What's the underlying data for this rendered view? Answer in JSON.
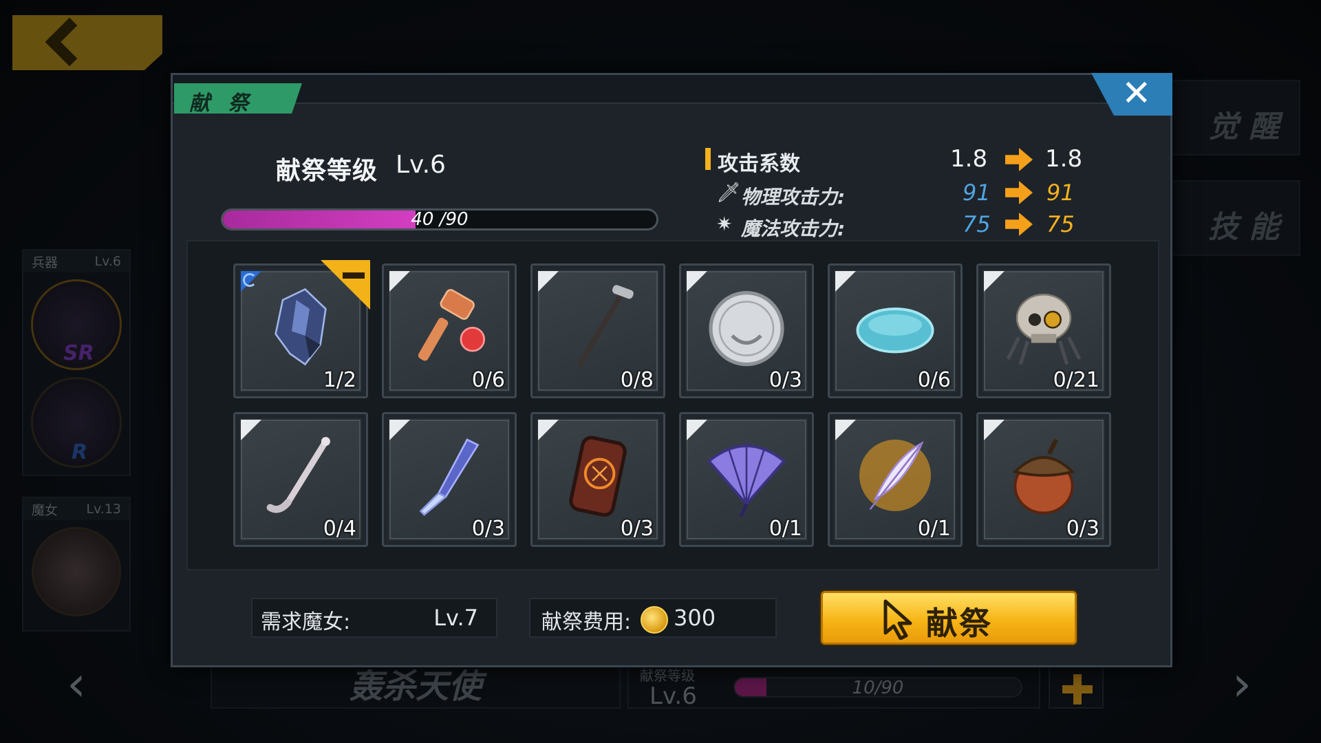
{
  "background": {
    "side_cards": [
      {
        "title": "兵器",
        "level": "Lv.6",
        "rarity": "SR",
        "rarity2": "R"
      },
      {
        "title": "魔女",
        "level": "Lv.13"
      }
    ],
    "right_tabs": [
      "觉 醒",
      "技 能"
    ],
    "bottom": {
      "name": "轰杀天使",
      "level_label": "献祭等级",
      "level_value": "Lv.6",
      "progress_text": "10/90",
      "progress": 0.11
    }
  },
  "modal": {
    "title": "献 祭",
    "close_label": "✕",
    "level_label": "献祭等级",
    "level_value": "Lv.6",
    "progress_text": "40 /90",
    "progress": 0.444,
    "stats": {
      "header": "攻击系数",
      "coef_from": "1.8",
      "coef_to": "1.8",
      "physical_label": "物理攻击力:",
      "physical_from": "91",
      "physical_to": "91",
      "magic_label": "魔法攻击力:",
      "magic_from": "75",
      "magic_to": "75"
    },
    "items": [
      {
        "name": "crystal-shard",
        "count": "1/2",
        "selected": true
      },
      {
        "name": "toy-mallet",
        "count": "0/6"
      },
      {
        "name": "walking-cane",
        "count": "0/8"
      },
      {
        "name": "silver-coin",
        "count": "0/3"
      },
      {
        "name": "soap-bar",
        "count": "0/6"
      },
      {
        "name": "spider-skull",
        "count": "0/21"
      },
      {
        "name": "pipe",
        "count": "0/4"
      },
      {
        "name": "butterfly-knife",
        "count": "0/3"
      },
      {
        "name": "rune-tablet",
        "count": "0/3"
      },
      {
        "name": "folding-fan",
        "count": "0/1"
      },
      {
        "name": "feather",
        "count": "0/1"
      },
      {
        "name": "acorn",
        "count": "0/3"
      }
    ],
    "requirement_label": "需求魔女:",
    "requirement_value": "Lv.7",
    "cost_label": "献祭费用:",
    "cost_value": "300",
    "sacrifice_button": "献祭"
  },
  "colors": {
    "accent_gold": "#f5b21e",
    "title_green": "#2e9a68",
    "close_blue": "#2b7eb6",
    "progress_purple": "#c235b2",
    "stat_blue": "#4fa4e1"
  }
}
